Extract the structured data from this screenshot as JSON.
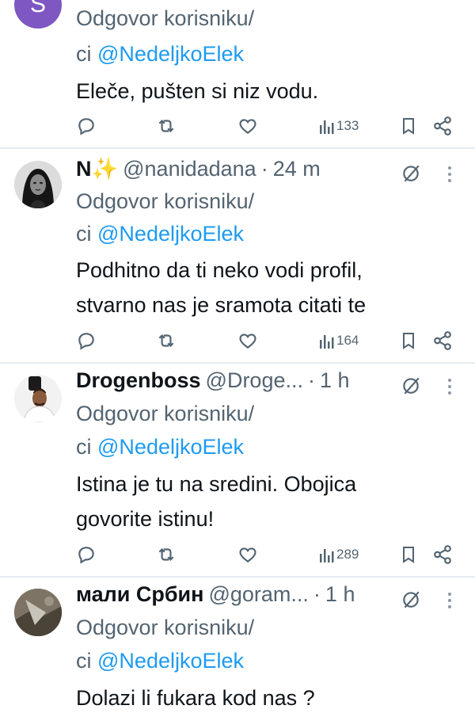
{
  "reply_label_prefix": "Odgovor korisniku/",
  "reply_label_suffix": "ci",
  "tweets": [
    {
      "avatar_letter": "S",
      "mention": "@NedeljkoElek",
      "body": [
        "Eleče, pušten si niz vodu."
      ],
      "views": "133"
    },
    {
      "name": "N✨",
      "handle": "@nanidadana",
      "time": "24 m",
      "mention": "@NedeljkoElek",
      "body": [
        "Podhitno  da ti neko  vodi profil,",
        "stvarno nas je sramota citati te"
      ],
      "views": "164"
    },
    {
      "name": "Drogenboss",
      "handle": "@Droge...",
      "time": "1 h",
      "mention": "@NedeljkoElek",
      "body": [
        "Istina je tu na sredini. Obojica",
        "govorite istinu!"
      ],
      "views": "289"
    },
    {
      "name": "мали Србин",
      "handle": "@goram...",
      "time": "1 h",
      "mention": "@NedeljkoElek",
      "body": [
        "Dolazi li fukara kod nas ?"
      ]
    }
  ],
  "icons": {
    "reply": "reply-icon",
    "retweet": "retweet-icon",
    "like": "heart-icon",
    "views": "views-icon",
    "bookmark": "bookmark-icon",
    "share": "share-icon",
    "grok": "grok-icon",
    "more": "more-icon"
  },
  "colors": {
    "text": "#0f1419",
    "secondary": "#536471",
    "link": "#1d9bf0",
    "separator": "#e6ecf0"
  }
}
